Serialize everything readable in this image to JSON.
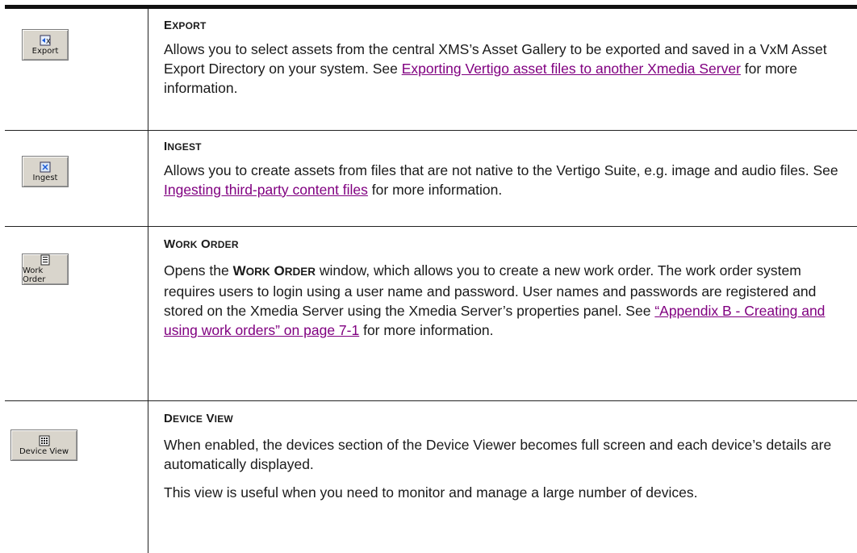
{
  "rows": [
    {
      "icon_label": "Export",
      "heading_first": "E",
      "heading_rest": "XPORT",
      "text_1": "Allows you to select assets from the central XMS’s Asset Gallery to be exported and saved in a VxM Asset Export Directory on your system. See ",
      "link": "Exporting Vertigo asset files to another Xmedia Server",
      "text_2": " for more information."
    },
    {
      "icon_label": "Ingest",
      "heading_first": "I",
      "heading_rest": "NGEST",
      "text_1": "Allows you to create assets from files that are not native to the Vertigo Suite, e.g. image and audio files. See ",
      "link": "Ingesting third-party content files",
      "text_2": " for more information."
    },
    {
      "icon_label": "Work Order",
      "heading_w1_first": "W",
      "heading_w1_rest": "ORK",
      "heading_w2_first": "O",
      "heading_w2_rest": "RDER",
      "text_0": "Opens the ",
      "sc_w1_first": "W",
      "sc_w1_rest": "ORK",
      "sc_w2_first": "O",
      "sc_w2_rest": "RDER",
      "text_1": " window, which allows you to create a new work order. The work order system requires users to login using a user name and password. User names and passwords are registered and stored on the Xmedia Server using the Xmedia Server’s properties panel. See ",
      "link": "“Appendix B - Creating and using work orders” on page 7-1",
      "text_2": " for more information."
    },
    {
      "icon_label": "Device View",
      "heading_w1_first": "D",
      "heading_w1_rest": "EVICE",
      "heading_w2_first": "V",
      "heading_w2_rest": "IEW",
      "text_1": "When enabled, the devices section of the Device Viewer becomes full screen and each device’s details are automatically displayed.",
      "text_2": "This view is useful when you need to monitor and manage a large number of devices."
    }
  ],
  "colors": {
    "link": "#800080",
    "rule": "#111111",
    "button_face": "#d9d5cc"
  },
  "icons": [
    "export-icon",
    "ingest-icon",
    "work-order-icon",
    "device-view-icon"
  ]
}
